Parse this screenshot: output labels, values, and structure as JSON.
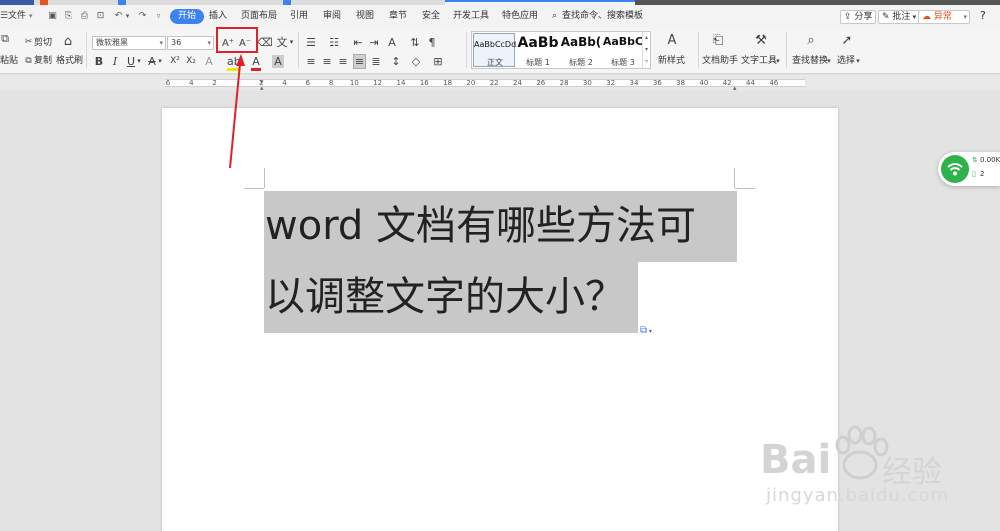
{
  "menubar": {
    "file_label": "文件",
    "tabs": [
      "开始",
      "插入",
      "页面布局",
      "引用",
      "审阅",
      "视图",
      "章节",
      "安全",
      "开发工具",
      "特色应用"
    ],
    "search_label": "查找命令、搜索模板",
    "share_label": "分享",
    "comment_label": "批注",
    "status_label": "异常",
    "help_label": "?"
  },
  "ribbon": {
    "paste_label": "粘贴",
    "cut_label": "剪切",
    "copy_label": "复制",
    "format_painter_label": "格式刷",
    "font_name": "微软雅黑",
    "font_size": "36",
    "grow_font_label": "A⁺",
    "shrink_font_label": "A⁻",
    "styles": [
      {
        "preview": "AaBbCcDd",
        "name": "正文"
      },
      {
        "preview": "AaBb",
        "name": "标题 1"
      },
      {
        "preview": "AaBb(",
        "name": "标题 2"
      },
      {
        "preview": "AaBbC",
        "name": "标题 3"
      }
    ],
    "new_style_label": "新样式",
    "doc_assistant_label": "文档助手",
    "text_tools_label": "文字工具",
    "find_replace_label": "查找替换",
    "select_label": "选择"
  },
  "ruler": {
    "labels": [
      "6",
      "4",
      "2",
      "",
      "2",
      "4",
      "6",
      "8",
      "10",
      "12",
      "14",
      "16",
      "18",
      "20",
      "22",
      "24",
      "26",
      "28",
      "30",
      "32",
      "34",
      "36",
      "38",
      "40",
      "42",
      "44",
      "46"
    ]
  },
  "document": {
    "lines": [
      "word 文档有哪些方法可",
      "以调整文字的大小？"
    ]
  },
  "net_widget": {
    "speed": "0.00K",
    "count": "2"
  },
  "watermark": {
    "brand_text": "Bai",
    "brand_suffix": "经验",
    "url_text": "jingyan.baidu.com"
  },
  "colors": {
    "accent": "#3c82f0",
    "annotation": "#e0202a",
    "selection": "#c8c8c8",
    "net_green": "#2db34a",
    "status_orange": "#e8521f"
  }
}
